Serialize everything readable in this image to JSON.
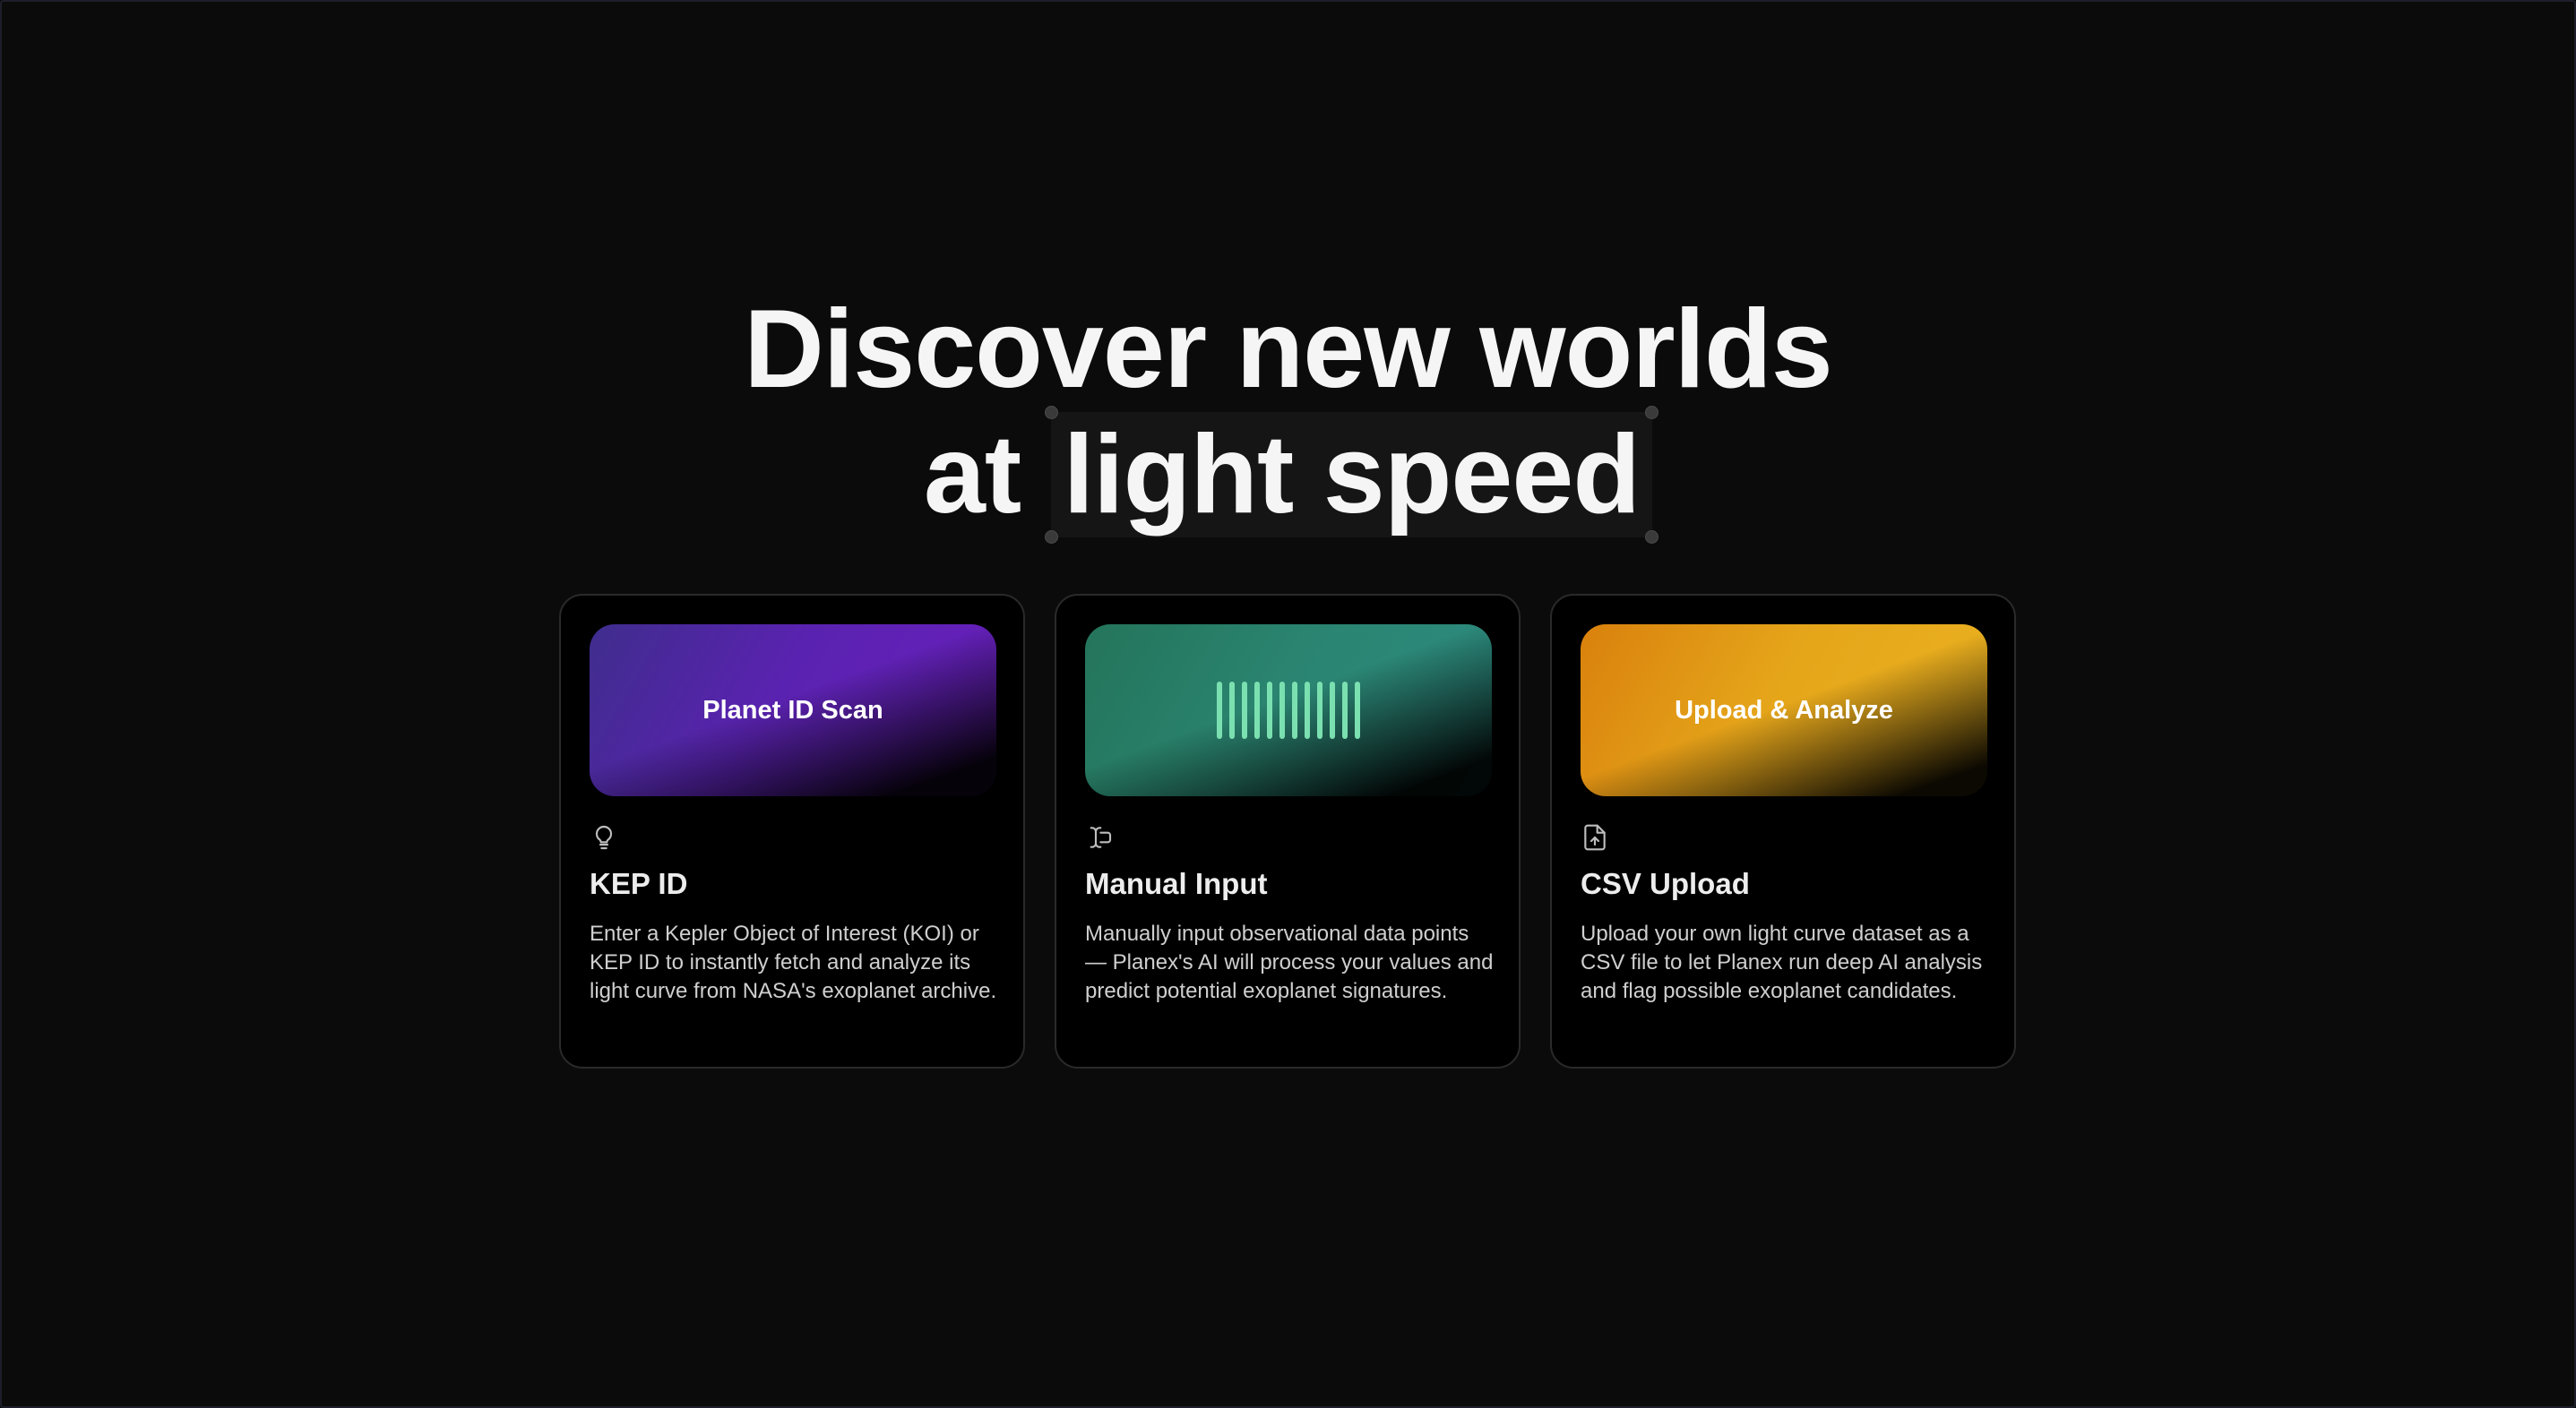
{
  "hero": {
    "line1": "Discover new worlds",
    "line2_prefix": "at",
    "line2_highlight": "light speed"
  },
  "cards": [
    {
      "banner_label": "Planet ID Scan",
      "icon": "lightbulb-icon",
      "title": "KEP ID",
      "description": "Enter a Kepler Object of Interest (KOI) or KEP ID to instantly fetch and analyze its light curve from NASA's exoplanet archive."
    },
    {
      "banner_label": "",
      "icon": "text-cursor-input-icon",
      "title": "Manual Input",
      "description": "Manually input observational data points — Planex's AI will process your values and predict potential exoplanet signatures."
    },
    {
      "banner_label": "Upload & Analyze",
      "icon": "file-upload-icon",
      "title": "CSV Upload",
      "description": "Upload your own light curve dataset as a CSV file to let Planex run deep AI analysis and flag possible exoplanet candidates."
    }
  ],
  "colors": {
    "background": "#0b0b0b",
    "card_background": "#000000",
    "purple": "#5a22b0",
    "teal": "#2a8470",
    "gold": "#e5a51a",
    "bar_accent": "#7be0b0"
  }
}
